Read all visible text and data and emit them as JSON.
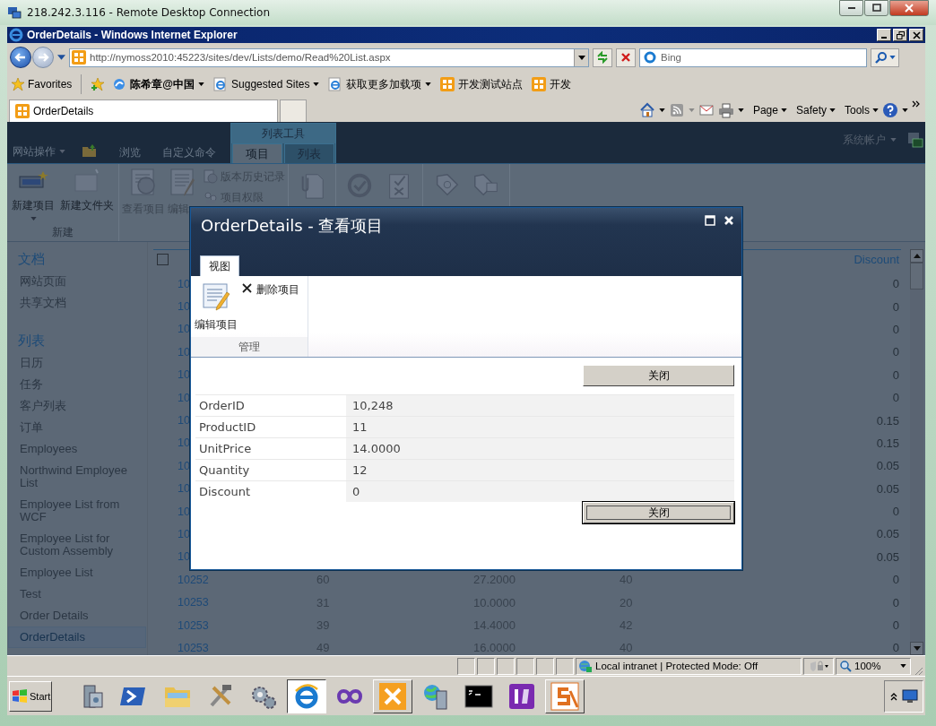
{
  "rdp_window": {
    "title": "218.242.3.116 - Remote Desktop Connection"
  },
  "ie_window": {
    "title": "OrderDetails - Windows Internet Explorer"
  },
  "address_bar": {
    "url": "http://nymoss2010:45223/sites/dev/Lists/demo/Read%20List.aspx",
    "search_placeholder": "Bing"
  },
  "favorites_bar": {
    "label": "Favorites",
    "items": [
      {
        "label": "陈希章@中国",
        "kind": "webslice",
        "dropdown": true
      },
      {
        "label": "Suggested Sites",
        "kind": "ie",
        "dropdown": true
      },
      {
        "label": "获取更多加载项",
        "kind": "ie",
        "dropdown": true
      },
      {
        "label": "开发测试站点",
        "kind": "sharepoint",
        "dropdown": false
      },
      {
        "label": "开发",
        "kind": "sharepoint",
        "dropdown": false
      }
    ]
  },
  "browser_tabs": [
    {
      "label": "OrderDetails",
      "selected": true
    }
  ],
  "command_bar": [
    "Page",
    "Safety",
    "Tools"
  ],
  "sharepoint": {
    "site_actions": "网站操作",
    "tabs": [
      {
        "label": "浏览",
        "selected": false
      },
      {
        "label": "自定义命令",
        "selected": false
      }
    ],
    "contextual_group": {
      "label": "列表工具",
      "tabs": [
        {
          "label": "项目",
          "selected": true
        },
        {
          "label": "列表",
          "selected": false
        }
      ]
    },
    "user": "系统帐户",
    "ribbon": {
      "new_group": {
        "label": "新建",
        "buttons": [
          {
            "label": "新建项目",
            "kind": "new-item",
            "dropdown": true
          },
          {
            "label": "新建文件夹",
            "kind": "new-folder",
            "dropdown": false
          }
        ]
      },
      "manage_buttons": [
        {
          "label": "查看项目",
          "kind": "view"
        },
        {
          "label": "编辑",
          "kind": "edit"
        }
      ],
      "small_buttons": [
        {
          "label": "版本历史记录",
          "kind": "history"
        },
        {
          "label": "项目权限",
          "kind": "permissions"
        }
      ]
    },
    "quick_launch": [
      {
        "heading": "文档",
        "items": [
          {
            "label": "网站页面",
            "selected": false
          },
          {
            "label": "共享文档",
            "selected": false
          }
        ]
      },
      {
        "heading": "列表",
        "items": [
          {
            "label": "日历",
            "selected": false
          },
          {
            "label": "任务",
            "selected": false
          },
          {
            "label": "客户列表",
            "selected": false
          },
          {
            "label": "订单",
            "selected": false
          },
          {
            "label": "Employees",
            "selected": false
          },
          {
            "label": "Northwind Employee List",
            "selected": false
          },
          {
            "label": "Employee List from WCF",
            "selected": false
          },
          {
            "label": "Employee List for Custom Assembly",
            "selected": false
          },
          {
            "label": "Employee List",
            "selected": false
          },
          {
            "label": "Test",
            "selected": false
          },
          {
            "label": "Order Details",
            "selected": false
          },
          {
            "label": "OrderDetails",
            "selected": true
          }
        ]
      }
    ],
    "list": {
      "select_all": {
        "checked": false
      },
      "columns": {
        "discount": "Discount"
      },
      "rows": [
        {
          "order_id": "10",
          "discount": "0"
        },
        {
          "order_id": "10",
          "discount": "0"
        },
        {
          "order_id": "10",
          "discount": "0"
        },
        {
          "order_id": "10",
          "discount": "0"
        },
        {
          "order_id": "10",
          "discount": "0"
        },
        {
          "order_id": "10",
          "discount": "0"
        },
        {
          "order_id": "10",
          "discount": "0.15"
        },
        {
          "order_id": "10",
          "discount": "0.15"
        },
        {
          "order_id": "10",
          "discount": "0.05"
        },
        {
          "order_id": "10",
          "discount": "0.05"
        },
        {
          "order_id": "10",
          "discount": "0"
        },
        {
          "order_id": "10",
          "discount": "0.05"
        },
        {
          "order_id": "10",
          "discount": "0.05"
        },
        {
          "order_id": "10252",
          "product_id": "60",
          "unit_price": "27.2000",
          "quantity": "40",
          "discount": "0"
        },
        {
          "order_id": "10253",
          "product_id": "31",
          "unit_price": "10.0000",
          "quantity": "20",
          "discount": "0"
        },
        {
          "order_id": "10253",
          "product_id": "39",
          "unit_price": "14.4000",
          "quantity": "42",
          "discount": "0"
        },
        {
          "order_id": "10253",
          "product_id": "49",
          "unit_price": "16.0000",
          "quantity": "40",
          "discount": "0"
        }
      ]
    },
    "dialog": {
      "title": "OrderDetails - 查看项目",
      "tabs": [
        {
          "label": "视图",
          "selected": true
        }
      ],
      "edit_button": "编辑项目",
      "delete_button": "删除项目",
      "group_label": "管理",
      "close_buttons": [
        {
          "label": "关闭",
          "focused": false
        },
        {
          "label": "关闭",
          "focused": true
        }
      ],
      "fields": [
        {
          "label": "OrderID",
          "value": "10,248"
        },
        {
          "label": "ProductID",
          "value": "11"
        },
        {
          "label": "UnitPrice",
          "value": "14.0000"
        },
        {
          "label": "Quantity",
          "value": "12"
        },
        {
          "label": "Discount",
          "value": "0"
        }
      ]
    }
  },
  "status_bar": {
    "zone": "Local intranet | Protected Mode: Off",
    "zoom": "100%"
  },
  "taskbar": {
    "start": "Start",
    "apps": [
      {
        "kind": "server",
        "selected": false
      },
      {
        "kind": "powershell",
        "selected": false
      },
      {
        "kind": "folder",
        "selected": false
      },
      {
        "kind": "tools",
        "selected": false
      },
      {
        "kind": "gears",
        "selected": false
      },
      {
        "kind": "ie",
        "selected": true
      },
      {
        "kind": "infinity",
        "selected": false
      },
      {
        "kind": "wrench",
        "selected": false
      },
      {
        "kind": "globe",
        "selected": false
      },
      {
        "kind": "console",
        "selected": false
      },
      {
        "kind": "infopath",
        "selected": false
      },
      {
        "kind": "designer",
        "selected": false
      }
    ]
  }
}
